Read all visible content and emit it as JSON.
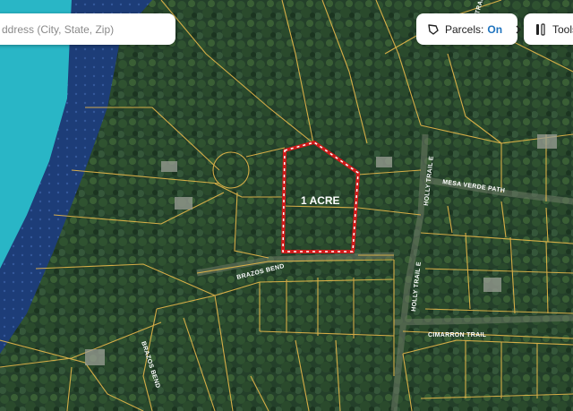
{
  "search": {
    "placeholder": "ddress (City, State, Zip)"
  },
  "parcels": {
    "label": "Parcels:",
    "state": "On"
  },
  "tools": {
    "label": "Tools"
  },
  "lot": {
    "label": "1 ACRE"
  },
  "roads": {
    "mesa_verde": "MESA VERDE PATH",
    "holly_trail_upper": "HOLLY TRAIL E",
    "holly_trail_lower": "HOLLY TRAIL E",
    "brazos_bend_main": "BRAZOS BEND",
    "brazos_bend_side": "BRAZOS BEND",
    "cimarron": "CIMARRON TRAIL",
    "top_trail": "TRAIL"
  },
  "colors": {
    "water": "#29b6c6",
    "parcel_lines": "#e8b84a",
    "lot_outline": "#d11a1a",
    "link": "#1e73be"
  }
}
